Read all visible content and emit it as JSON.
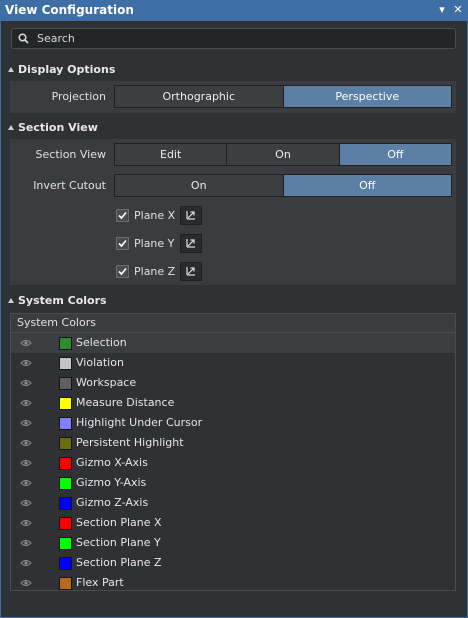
{
  "panel": {
    "title": "View Configuration"
  },
  "search": {
    "placeholder": "Search"
  },
  "display_options": {
    "title": "Display Options",
    "projection_label": "Projection",
    "projection_options": [
      "Orthographic",
      "Perspective"
    ],
    "projection_selected": "Perspective"
  },
  "section_view": {
    "title": "Section View",
    "section_view_label": "Section View",
    "section_view_options": [
      "Edit",
      "On",
      "Off"
    ],
    "section_view_selected": "Off",
    "invert_cutout_label": "Invert Cutout",
    "invert_cutout_options": [
      "On",
      "Off"
    ],
    "invert_cutout_selected": "Off",
    "planes": [
      {
        "label": "Plane X",
        "checked": true
      },
      {
        "label": "Plane Y",
        "checked": true
      },
      {
        "label": "Plane Z",
        "checked": true
      }
    ]
  },
  "system_colors": {
    "title": "System Colors",
    "header": "System Colors",
    "items": [
      {
        "name": "Selection",
        "color": "#2e8b2e",
        "visible": true
      },
      {
        "name": "Violation",
        "color": "#c4c4c4",
        "visible": true
      },
      {
        "name": "Workspace",
        "color": "#5f5f5f",
        "visible": true
      },
      {
        "name": "Measure Distance",
        "color": "#ffff00",
        "visible": true
      },
      {
        "name": "Highlight Under Cursor",
        "color": "#8080ff",
        "visible": true
      },
      {
        "name": "Persistent Highlight",
        "color": "#6b6b10",
        "visible": true
      },
      {
        "name": "Gizmo X-Axis",
        "color": "#ff0000",
        "visible": true
      },
      {
        "name": "Gizmo Y-Axis",
        "color": "#00ff00",
        "visible": true
      },
      {
        "name": "Gizmo Z-Axis",
        "color": "#0000ff",
        "visible": true
      },
      {
        "name": "Section Plane X",
        "color": "#ff0000",
        "visible": true
      },
      {
        "name": "Section Plane Y",
        "color": "#00ff00",
        "visible": true
      },
      {
        "name": "Section Plane Z",
        "color": "#0000ff",
        "visible": true
      },
      {
        "name": "Flex Part",
        "color": "#b86a1c",
        "visible": true
      }
    ]
  }
}
